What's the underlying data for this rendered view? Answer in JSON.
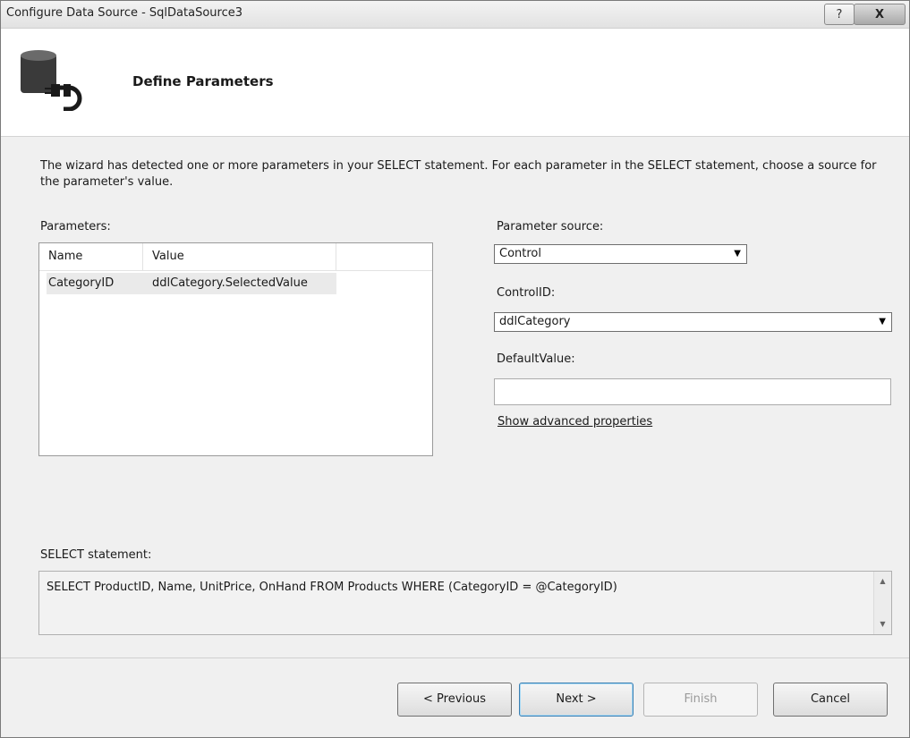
{
  "window": {
    "title": "Configure Data Source - SqlDataSource3",
    "help_glyph": "?",
    "close_glyph": "X"
  },
  "header": {
    "heading": "Define Parameters"
  },
  "intro_text": "The wizard has detected one or more parameters in your SELECT statement. For each parameter in the SELECT statement, choose a source for the parameter's value.",
  "parameters": {
    "label": "Parameters:",
    "columns": [
      "Name",
      "Value"
    ],
    "rows": [
      {
        "name": "CategoryID",
        "value": "ddlCategory.SelectedValue"
      }
    ]
  },
  "right_panel": {
    "source_label": "Parameter source:",
    "source_value": "Control",
    "control_label": "ControlID:",
    "control_value": "ddlCategory",
    "default_label": "DefaultValue:",
    "default_value": "",
    "advanced_link": "Show advanced properties"
  },
  "select_statement": {
    "label": "SELECT statement:",
    "sql": "SELECT ProductID, Name, UnitPrice, OnHand FROM Products WHERE (CategoryID = @CategoryID)"
  },
  "buttons": {
    "previous": "< Previous",
    "next": "Next >",
    "finish": "Finish",
    "cancel": "Cancel"
  },
  "icons": {
    "help": "help-icon",
    "close": "close-icon",
    "header": "database-plug-icon",
    "dropdown": "chevron-down-icon"
  }
}
